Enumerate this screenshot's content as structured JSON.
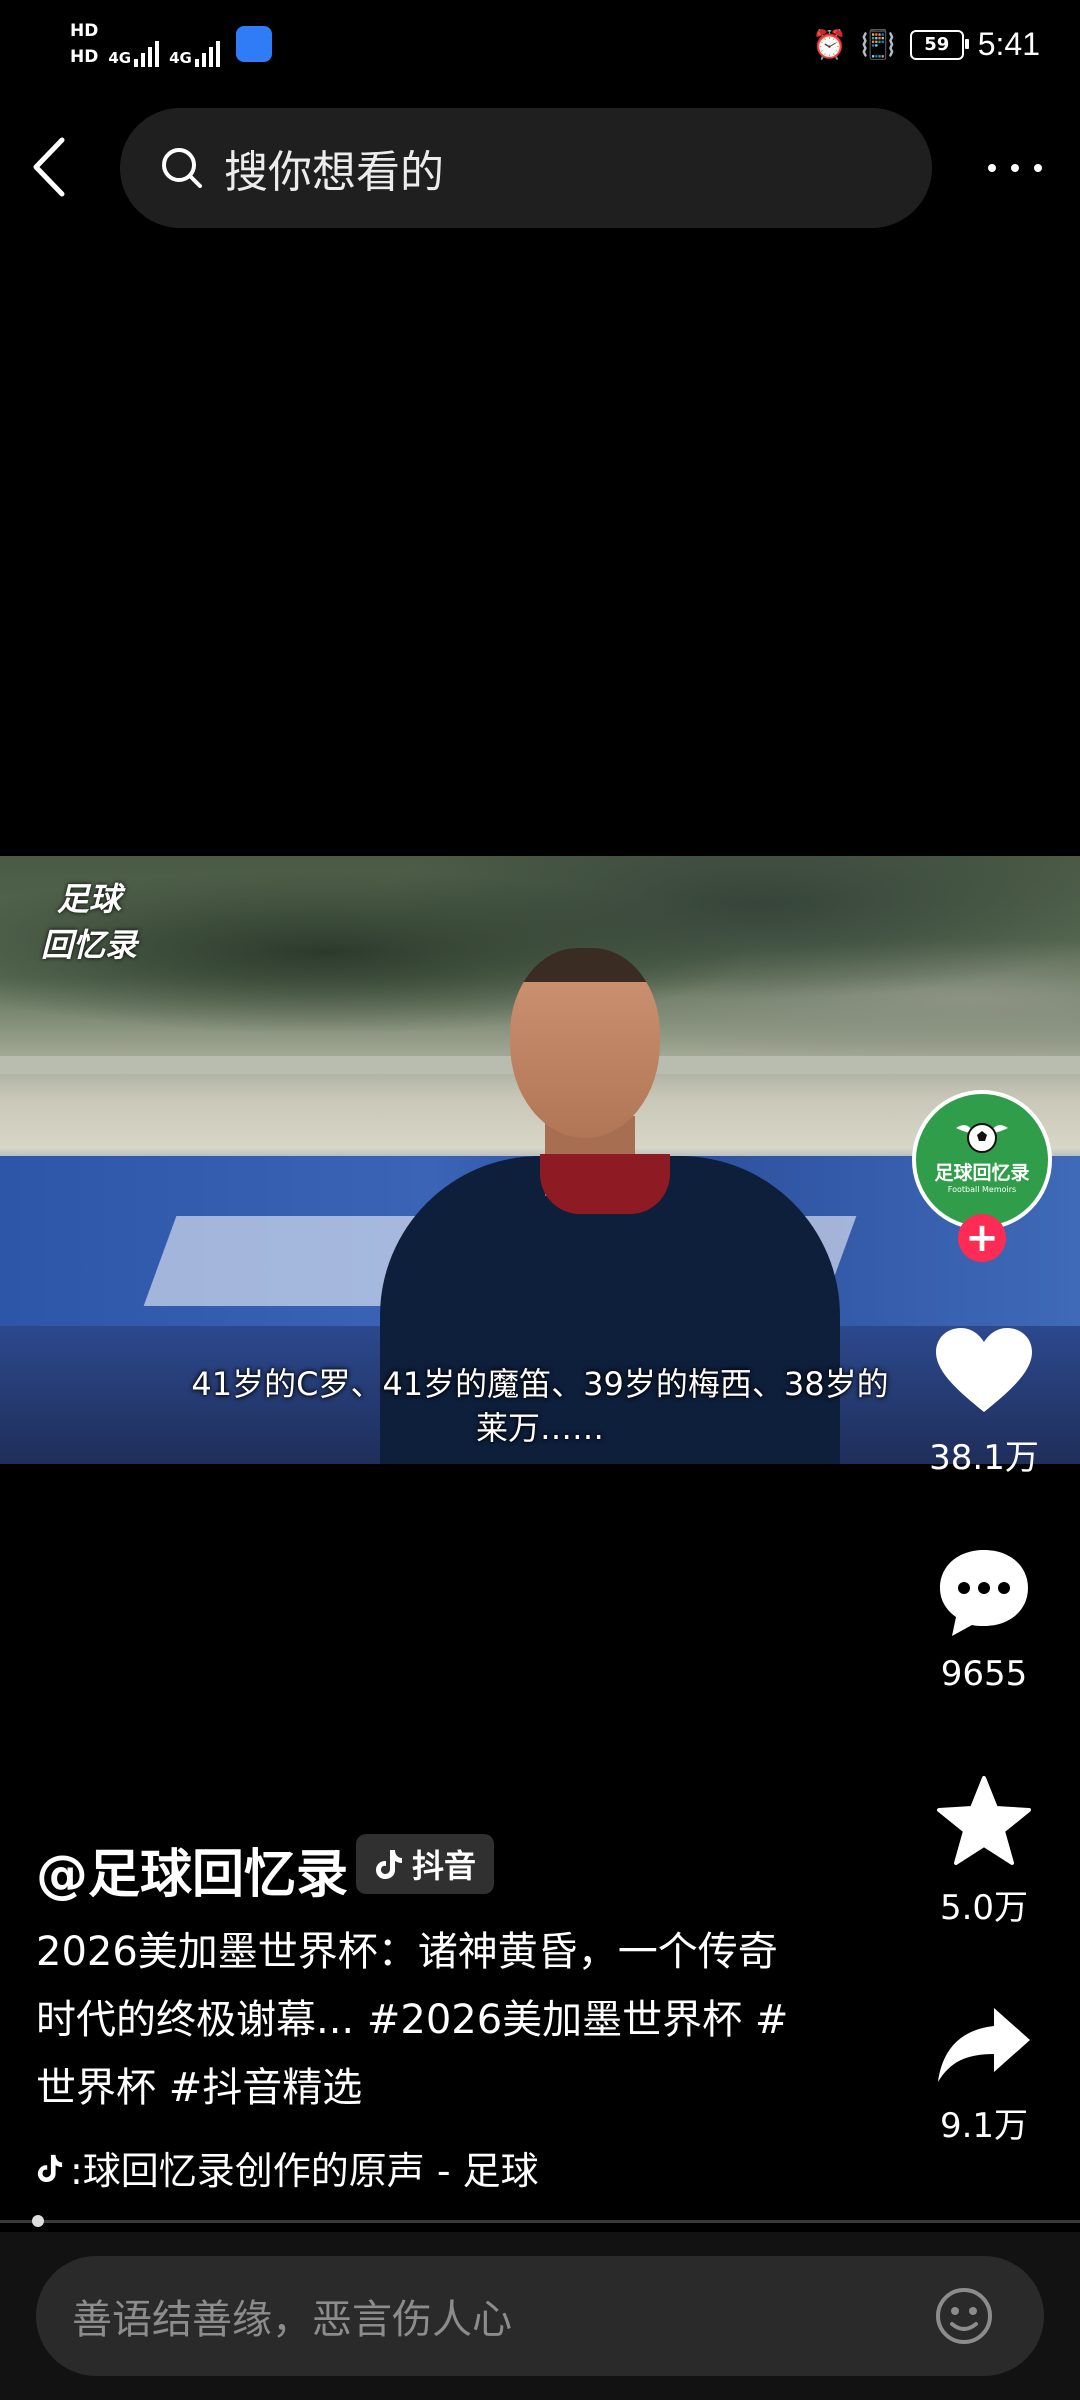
{
  "status_bar": {
    "hd1": "HD",
    "hd2": "HD",
    "sim1": "4G",
    "sim2": "4G",
    "battery": "59",
    "time": "5:41"
  },
  "top_bar": {
    "search_placeholder": "搜你想看的"
  },
  "video": {
    "watermark_line1": "足球",
    "watermark_line2": "回忆录",
    "subtitle_line1": "41岁的C罗、41岁的魔笛、39岁的梅西、38岁的",
    "subtitle_line2": "莱万……"
  },
  "creator": {
    "avatar_name": "足球回忆录",
    "avatar_sub": "Football Memoirs",
    "follow_symbol": "+"
  },
  "actions": {
    "likes": "38.1万",
    "comments": "9655",
    "favorites": "5.0万",
    "shares": "9.1万"
  },
  "post": {
    "author": "@足球回忆录",
    "platform_tag": "抖音",
    "description": "2026美加墨世界杯：诸神黄昏，一个传奇时代的终极谢幕... #2026美加墨世界杯 #世界杯 #抖音精选",
    "music": ":球回忆录创作的原声 - 足球"
  },
  "comment_bar": {
    "placeholder": "善语结善缘，恶言伤人心"
  },
  "colors": {
    "accent": "#fe2c55",
    "avatar_bg": "#2f9d4a",
    "search_bg": "#1f1f1f"
  }
}
